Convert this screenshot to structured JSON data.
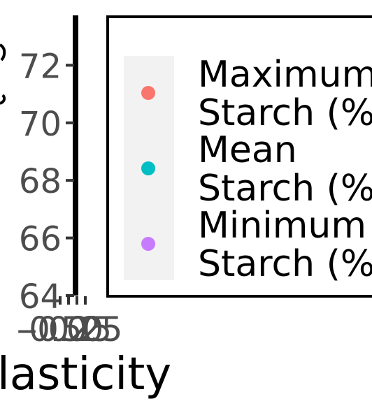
{
  "chart_data": {
    "type": "scatter",
    "title": "",
    "xlabel": "lasticity",
    "ylabel": "",
    "x_ticks": [
      "-0.50",
      "-0.25",
      "0",
      "0.25"
    ],
    "y_ticks": [
      "64",
      "66",
      "68",
      "70",
      "72"
    ],
    "ylim": [
      64,
      73.7
    ],
    "grid": false,
    "legend_position": "right",
    "series": [
      {
        "name": "Maximum Starch (%)",
        "name_lines": [
          "Maximum",
          "Starch (%"
        ],
        "color": "#F8766D",
        "values": []
      },
      {
        "name": "Mean Starch (%)",
        "name_lines": [
          "Mean",
          "Starch (%"
        ],
        "color": "#00BFC4",
        "values": []
      },
      {
        "name": "Minimum Starch (%)",
        "name_lines": [
          "Minimum",
          "Starch (%"
        ],
        "color": "#C77CFF",
        "values": []
      }
    ]
  }
}
